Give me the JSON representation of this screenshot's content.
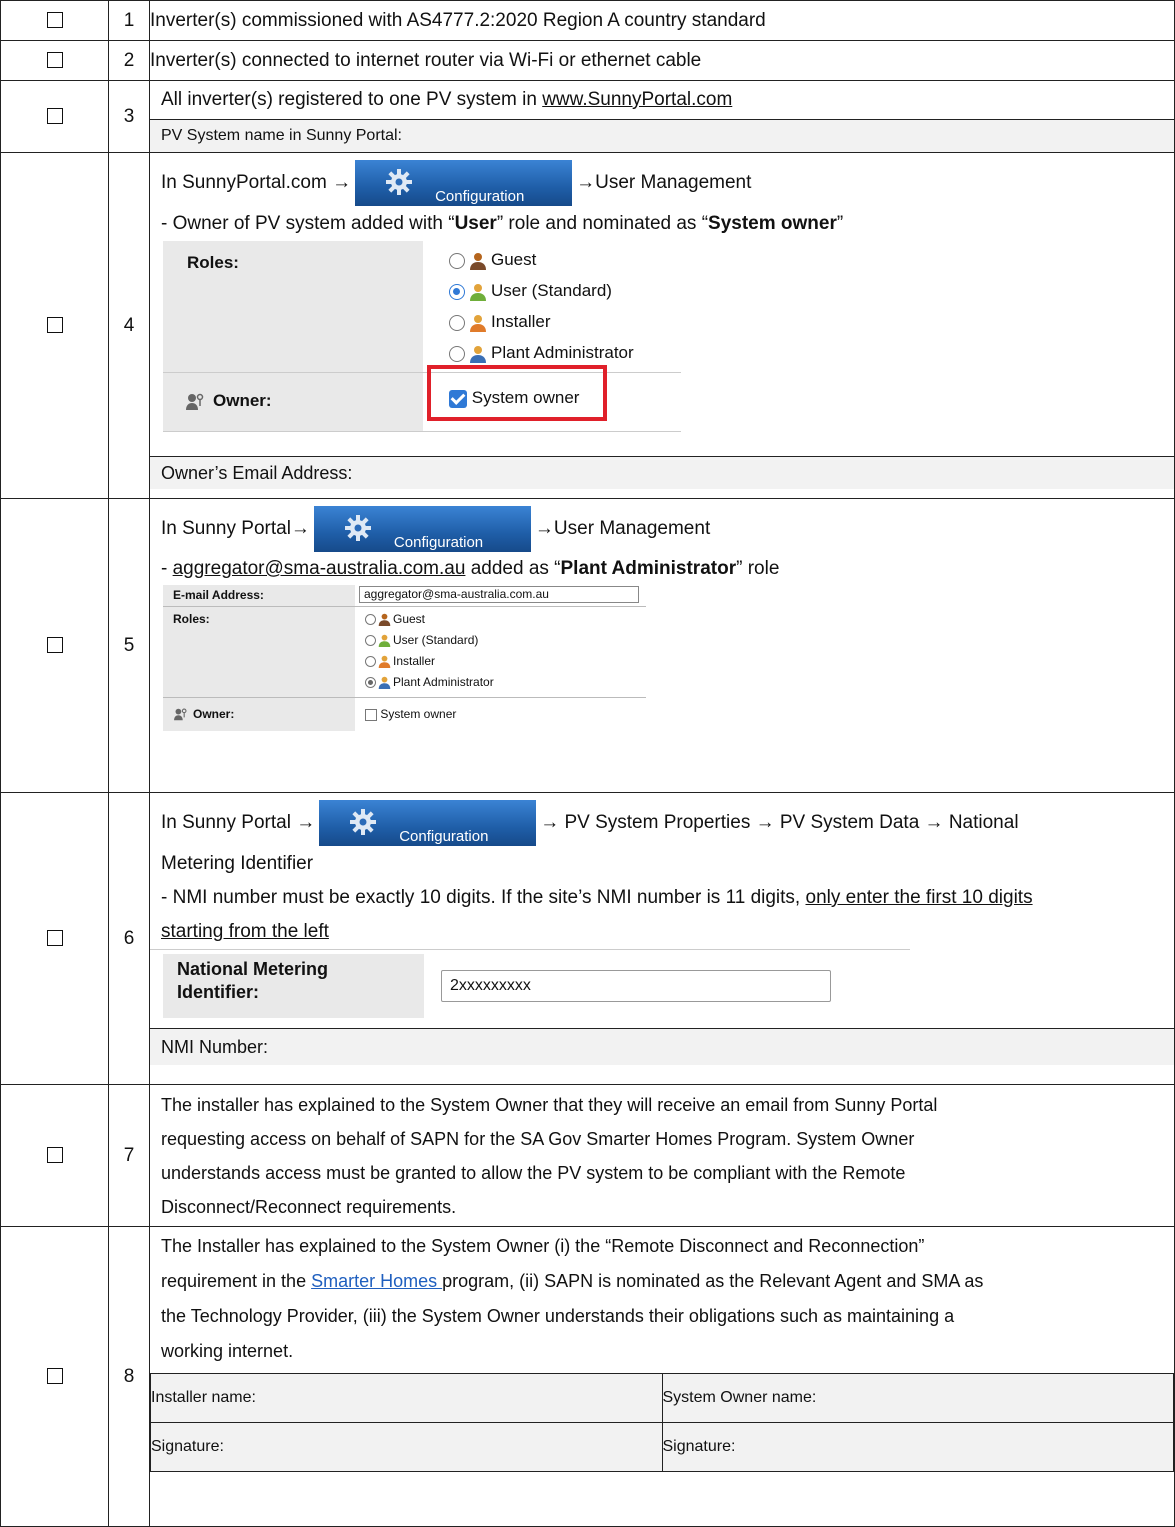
{
  "rows": [
    {
      "num": "1",
      "text": "Inverter(s) commissioned with AS4777.2:2020 Region A country standard"
    },
    {
      "num": "2",
      "text": "Inverter(s) connected to internet router via Wi-Fi or ethernet cable"
    },
    {
      "num": "3",
      "text_pre": "All inverter(s) registered to one PV system in ",
      "link": "www.SunnyPortal.com",
      "sub_label": "PV System name in Sunny Portal:"
    },
    {
      "num": "4",
      "nav_pre": "In SunnyPortal.com →",
      "nav_post": "→User Management",
      "line2_pre": "- Owner of PV system added with “",
      "line2_b1": "User",
      "line2_mid": "” role and nominated as “",
      "line2_b2": "System owner",
      "line2_post": "”",
      "panel": {
        "roles_label": "Roles:",
        "owner_label": "Owner:",
        "options": [
          "Guest",
          "User (Standard)",
          "Installer",
          "Plant Administrator"
        ],
        "selected": "User (Standard)",
        "checkbox_label": "System owner",
        "checkbox_checked": true
      },
      "sub_label": "Owner’s Email Address:"
    },
    {
      "num": "5",
      "nav_pre": "In Sunny Portal→",
      "nav_post": "→User Management",
      "line2_pre": "- ",
      "line2_link": "aggregator@sma-australia.com.au",
      "line2_mid": " added as “",
      "line2_b": "Plant Administrator",
      "line2_post": "” role",
      "panel": {
        "email_label": "E-mail Address:",
        "email_value": "aggregator@sma-australia.com.au",
        "roles_label": "Roles:",
        "owner_label": "Owner:",
        "options": [
          "Guest",
          "User (Standard)",
          "Installer",
          "Plant Administrator"
        ],
        "selected": "Plant Administrator",
        "checkbox_label": "System owner",
        "checkbox_checked": false
      }
    },
    {
      "num": "6",
      "nav_pre": "In Sunny Portal →",
      "nav_post": "→ PV System Properties → PV System Data → National",
      "nav_line2": "Metering Identifier",
      "line3_a": "- NMI number must be exactly 10 digits. If the site’s NMI number is 11 digits, ",
      "line3_u": "only enter the first 10 digits",
      "line4_u": "starting from the left",
      "panel": {
        "label_l1": "National Metering",
        "label_l2": "Identifier:",
        "value": "2xxxxxxxxx"
      },
      "sub_label": "NMI Number:"
    },
    {
      "num": "7",
      "lines": [
        "The installer has explained to the System Owner that they will receive an email from Sunny Portal",
        "requesting access on behalf of SAPN for the SA Gov Smarter Homes Program. System Owner",
        "understands access must be granted to allow the PV system to be compliant with the Remote",
        "Disconnect/Reconnect requirements."
      ]
    },
    {
      "num": "8",
      "line1": "The Installer has explained to the System Owner (i) the “Remote Disconnect and Reconnection”",
      "line2_pre": "requirement in the ",
      "line2_link": "Smarter Homes ",
      "line2_post": "program, (ii) SAPN is nominated as the Relevant Agent and SMA as",
      "line3": "the Technology Provider, (iii) the System Owner understands their obligations such as maintaining a",
      "line4": "working internet.",
      "installer_name": "Installer name:",
      "owner_name": "System Owner name:",
      "signature_l": "Signature:",
      "signature_r": "Signature:"
    }
  ],
  "config_button_label": "Configuration",
  "colors": {
    "config_bg": "#1f5ea8",
    "highlight": "#e0202a",
    "accent": "#2f79d6",
    "link": "#1f5fbf"
  }
}
